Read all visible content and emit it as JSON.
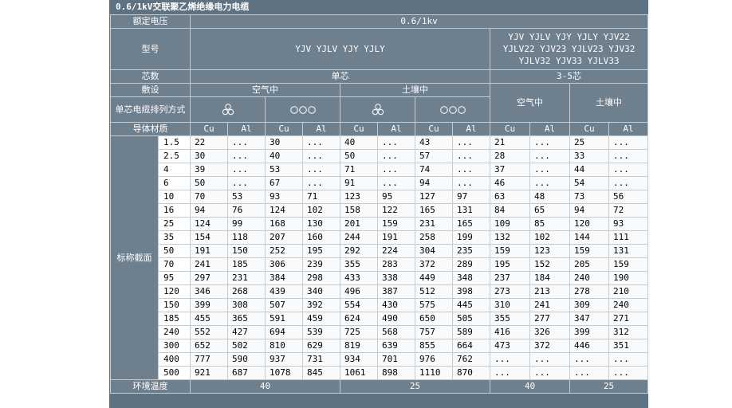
{
  "title": "0.6/1kV交联聚乙烯绝缘电力电缆",
  "header": {
    "rated_voltage_label": "额定电压",
    "rated_voltage_value": "0.6/1kv",
    "model_label": "型号",
    "model_single": "YJV YJLV YJY YJLY",
    "model_multi": "YJV YJLV YJY YJLY YJV22 YJLV22 YJV23 YJLV23 YJV32 YJLV32 YJV33 YJLV33",
    "cores_label": "芯数",
    "cores_single": "单芯",
    "cores_multi": "3-5芯",
    "laying_label": "敷设",
    "laying_air": "空气中",
    "laying_soil": "土壤中",
    "arrangement_label": "单芯电缆排列方式",
    "arrangement_trefoil": "trefoil-arrangement-icon",
    "arrangement_flat": "flat-arrangement-icon",
    "multi_air": "空气中",
    "multi_soil": "土壤中",
    "conductor_label": "导体材质",
    "cu": "Cu",
    "al": "Al"
  },
  "section_label": "标称截面",
  "rows": [
    {
      "size": "1.5",
      "v": [
        "22",
        "...",
        "30",
        "...",
        "40",
        "...",
        "43",
        "...",
        "21",
        "...",
        "25",
        "..."
      ]
    },
    {
      "size": "2.5",
      "v": [
        "30",
        "...",
        "40",
        "...",
        "50",
        "...",
        "57",
        "...",
        "28",
        "...",
        "33",
        "..."
      ]
    },
    {
      "size": "4",
      "v": [
        "39",
        "...",
        "53",
        "...",
        "71",
        "...",
        "74",
        "...",
        "37",
        "...",
        "44",
        "..."
      ]
    },
    {
      "size": "6",
      "v": [
        "50",
        "...",
        "67",
        "...",
        "91",
        "...",
        "94",
        "...",
        "46",
        "...",
        "54",
        "..."
      ]
    },
    {
      "size": "10",
      "v": [
        "70",
        "53",
        "93",
        "71",
        "123",
        "95",
        "127",
        "97",
        "63",
        "48",
        "73",
        "56"
      ]
    },
    {
      "size": "16",
      "v": [
        "94",
        "76",
        "124",
        "102",
        "158",
        "122",
        "165",
        "131",
        "84",
        "65",
        "94",
        "72"
      ]
    },
    {
      "size": "25",
      "v": [
        "124",
        "99",
        "168",
        "130",
        "201",
        "159",
        "231",
        "165",
        "109",
        "85",
        "120",
        "93"
      ]
    },
    {
      "size": "35",
      "v": [
        "154",
        "118",
        "207",
        "160",
        "244",
        "191",
        "258",
        "199",
        "132",
        "102",
        "144",
        "111"
      ]
    },
    {
      "size": "50",
      "v": [
        "191",
        "150",
        "252",
        "195",
        "292",
        "224",
        "304",
        "235",
        "159",
        "123",
        "159",
        "131"
      ]
    },
    {
      "size": "70",
      "v": [
        "241",
        "185",
        "306",
        "239",
        "355",
        "283",
        "372",
        "289",
        "195",
        "152",
        "205",
        "159"
      ]
    },
    {
      "size": "95",
      "v": [
        "297",
        "231",
        "384",
        "298",
        "433",
        "338",
        "449",
        "348",
        "237",
        "184",
        "240",
        "190"
      ]
    },
    {
      "size": "120",
      "v": [
        "346",
        "268",
        "439",
        "340",
        "496",
        "387",
        "512",
        "398",
        "273",
        "213",
        "278",
        "210"
      ]
    },
    {
      "size": "150",
      "v": [
        "399",
        "308",
        "507",
        "392",
        "554",
        "430",
        "575",
        "445",
        "310",
        "241",
        "309",
        "240"
      ]
    },
    {
      "size": "185",
      "v": [
        "455",
        "365",
        "591",
        "459",
        "624",
        "490",
        "650",
        "505",
        "355",
        "277",
        "347",
        "271"
      ]
    },
    {
      "size": "240",
      "v": [
        "552",
        "427",
        "694",
        "539",
        "725",
        "568",
        "757",
        "589",
        "416",
        "326",
        "399",
        "312"
      ]
    },
    {
      "size": "300",
      "v": [
        "652",
        "502",
        "810",
        "629",
        "819",
        "639",
        "855",
        "664",
        "473",
        "372",
        "446",
        "351"
      ]
    },
    {
      "size": "400",
      "v": [
        "777",
        "590",
        "937",
        "731",
        "934",
        "701",
        "976",
        "762",
        "...",
        "...",
        "...",
        "..."
      ]
    },
    {
      "size": "500",
      "v": [
        "921",
        "687",
        "1078",
        "845",
        "1061",
        "898",
        "1110",
        "870",
        "...",
        "...",
        "...",
        "..."
      ]
    }
  ],
  "footer": {
    "label": "环境温度",
    "single_air": "40",
    "single_soil": "25",
    "multi_air": "40",
    "multi_soil": "25"
  }
}
